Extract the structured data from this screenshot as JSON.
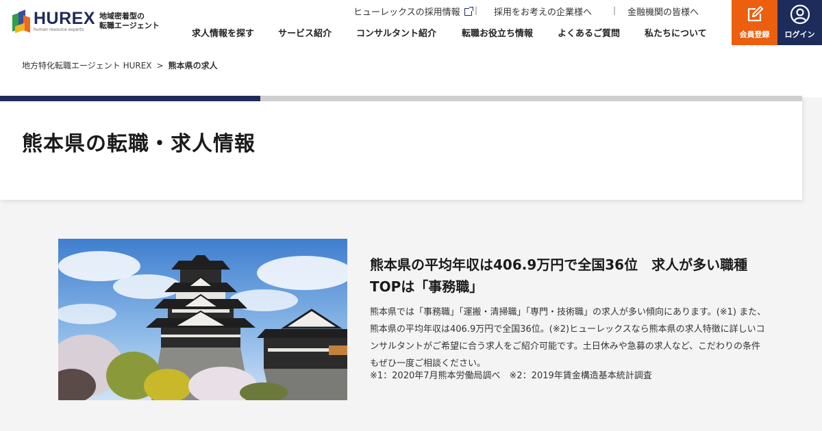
{
  "header": {
    "logo": {
      "word": "HUREX",
      "sub": "human resource experts",
      "tagline_line1": "地域密着型の",
      "tagline_line2": "転職エージェント"
    },
    "util_nav": [
      {
        "label": "ヒューレックスの採用情報"
      },
      {
        "label": "採用をお考えの企業様へ"
      },
      {
        "label": "金融機関の皆様へ"
      }
    ],
    "main_nav": [
      {
        "label": "求人情報を探す"
      },
      {
        "label": "サービス紹介"
      },
      {
        "label": "コンサルタント紹介"
      },
      {
        "label": "転職お役立ち情報"
      },
      {
        "label": "よくあるご質問"
      },
      {
        "label": "私たちについて"
      }
    ],
    "register_label": "会員登録",
    "login_label": "ログイン",
    "colors": {
      "navy": "#1d2c5b",
      "orange": "#ec5f0e"
    }
  },
  "breadcrumb": {
    "home": "地方特化転職エージェント HUREX",
    "separator": ">",
    "current": "熊本県の求人"
  },
  "page": {
    "title": "熊本県の転職・求人情報"
  },
  "content": {
    "headline": "熊本県の平均年収は406.9万円で全国36位　求人が多い職種TOPは「事務職」",
    "body": "熊本県では「事務職」「運搬・清掃職」「専門・技術職」の求人が多い傾向にあります。(※1) また、熊本県の平均年収は406.9万円で全国36位。(※2)ヒューレックスなら熊本県の求人特徴に詳しいコンサルタントがご希望に合う求人をご紹介可能です。土日休みや急募の求人など、こだわりの条件もぜひ一度ご相談ください。",
    "notes": "※1：2020年7月熊本労働局調べ　※2：2019年賃金構造基本統計調査"
  }
}
